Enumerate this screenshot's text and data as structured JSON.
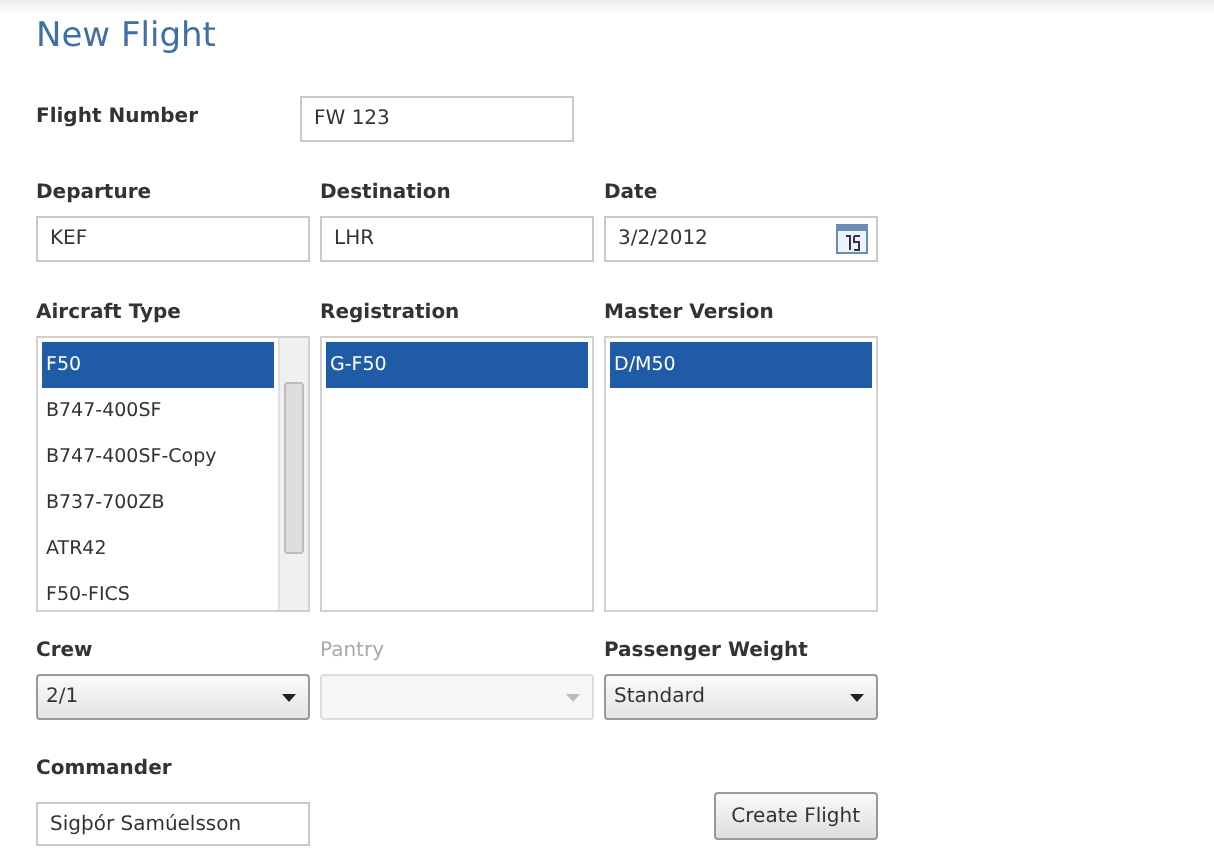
{
  "title": "New Flight",
  "flight_number": {
    "label": "Flight Number",
    "value": "FW 123"
  },
  "route": [
    {
      "kind": "text",
      "label": "Departure",
      "value": "KEF"
    },
    {
      "kind": "text",
      "label": "Destination",
      "value": "LHR"
    },
    {
      "kind": "date",
      "label": "Date",
      "value": "3/2/2012"
    }
  ],
  "lists": [
    {
      "label": "Aircraft Type",
      "scrollbar": true,
      "items": [
        {
          "text": "F50",
          "selected": true
        },
        {
          "text": "B747-400SF",
          "selected": false
        },
        {
          "text": "B747-400SF-Copy",
          "selected": false
        },
        {
          "text": "B737-700ZB",
          "selected": false
        },
        {
          "text": "ATR42",
          "selected": false
        },
        {
          "text": "F50-FICS",
          "selected": false
        }
      ]
    },
    {
      "label": "Registration",
      "scrollbar": false,
      "items": [
        {
          "text": "G-F50",
          "selected": true
        }
      ]
    },
    {
      "label": "Master Version",
      "scrollbar": false,
      "items": [
        {
          "text": "D/M50",
          "selected": true
        }
      ]
    }
  ],
  "combos": [
    {
      "label": "Crew",
      "value": "2/1",
      "disabled": false
    },
    {
      "label": "Pantry",
      "disabled": true
    },
    {
      "label": "Passenger Weight",
      "value": "Standard",
      "disabled": false
    }
  ],
  "commander": {
    "label": "Commander",
    "value": "Sigþór Samúelsson"
  },
  "button": "Create Flight"
}
